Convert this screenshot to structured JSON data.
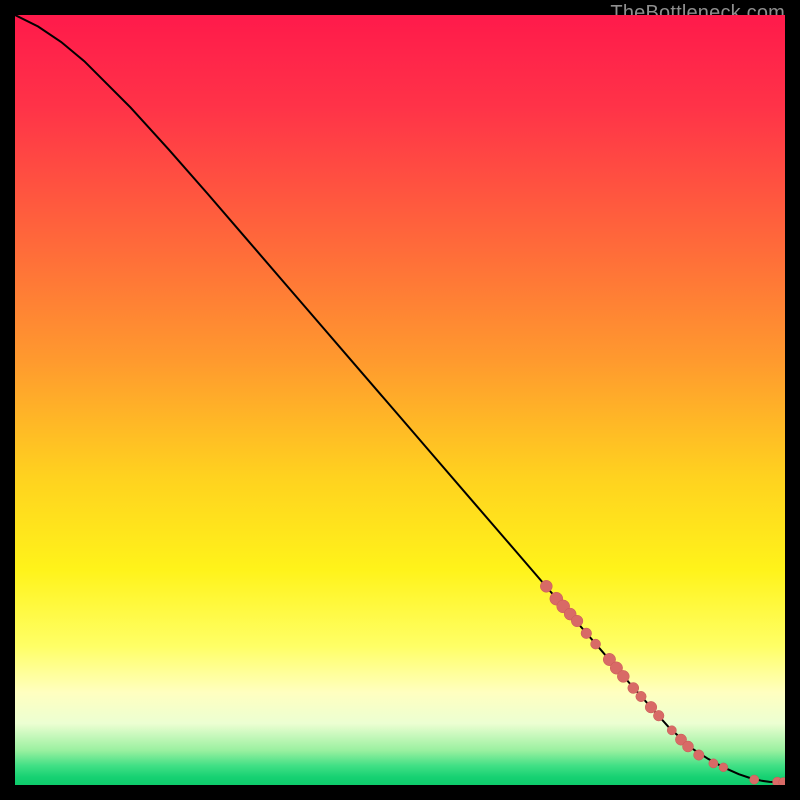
{
  "watermark": "TheBottleneck.com",
  "colors": {
    "gradient_stops": [
      {
        "offset": 0.0,
        "color": "#ff1a4b"
      },
      {
        "offset": 0.12,
        "color": "#ff3348"
      },
      {
        "offset": 0.3,
        "color": "#ff6a3a"
      },
      {
        "offset": 0.45,
        "color": "#ff9a2e"
      },
      {
        "offset": 0.6,
        "color": "#ffd21f"
      },
      {
        "offset": 0.72,
        "color": "#fff31a"
      },
      {
        "offset": 0.82,
        "color": "#ffff66"
      },
      {
        "offset": 0.88,
        "color": "#ffffc0"
      },
      {
        "offset": 0.92,
        "color": "#ecffd2"
      },
      {
        "offset": 0.955,
        "color": "#9af0a0"
      },
      {
        "offset": 0.975,
        "color": "#41e085"
      },
      {
        "offset": 0.99,
        "color": "#16d172"
      },
      {
        "offset": 1.0,
        "color": "#0ecb6b"
      }
    ],
    "curve": "#000000",
    "marker_fill": "#d86a66",
    "marker_stroke": "#c95a56"
  },
  "chart_data": {
    "type": "line",
    "title": "",
    "xlabel": "",
    "ylabel": "",
    "xlim": [
      0,
      100
    ],
    "ylim": [
      0,
      100
    ],
    "series": [
      {
        "name": "curve",
        "x": [
          0,
          3,
          6,
          9,
          12,
          15,
          20,
          25,
          30,
          35,
          40,
          45,
          50,
          55,
          60,
          65,
          70,
          75,
          80,
          85,
          88,
          90,
          92,
          94,
          95.5,
          97,
          98,
          99,
          100
        ],
        "y": [
          100,
          98.5,
          96.5,
          94,
          91,
          88,
          82.5,
          76.8,
          71,
          65.2,
          59.4,
          53.6,
          47.8,
          42,
          36.2,
          30.4,
          24.6,
          18.8,
          13,
          7.4,
          4.7,
          3.4,
          2.3,
          1.4,
          0.9,
          0.55,
          0.4,
          0.35,
          0.35
        ]
      }
    ],
    "markers": [
      {
        "x": 69.0,
        "y": 25.8,
        "r": 6.0
      },
      {
        "x": 70.3,
        "y": 24.2,
        "r": 6.5
      },
      {
        "x": 71.2,
        "y": 23.2,
        "r": 6.5
      },
      {
        "x": 72.1,
        "y": 22.2,
        "r": 6.0
      },
      {
        "x": 73.0,
        "y": 21.3,
        "r": 5.8
      },
      {
        "x": 74.2,
        "y": 19.7,
        "r": 5.3
      },
      {
        "x": 75.4,
        "y": 18.3,
        "r": 5.0
      },
      {
        "x": 77.2,
        "y": 16.3,
        "r": 6.2
      },
      {
        "x": 78.1,
        "y": 15.2,
        "r": 6.2
      },
      {
        "x": 79.0,
        "y": 14.1,
        "r": 6.0
      },
      {
        "x": 80.3,
        "y": 12.6,
        "r": 5.5
      },
      {
        "x": 81.3,
        "y": 11.5,
        "r": 5.2
      },
      {
        "x": 82.6,
        "y": 10.1,
        "r": 5.8
      },
      {
        "x": 83.6,
        "y": 9.0,
        "r": 5.3
      },
      {
        "x": 85.3,
        "y": 7.1,
        "r": 4.6
      },
      {
        "x": 86.5,
        "y": 5.9,
        "r": 5.6
      },
      {
        "x": 87.4,
        "y": 5.0,
        "r": 5.5
      },
      {
        "x": 88.8,
        "y": 3.9,
        "r": 5.2
      },
      {
        "x": 90.7,
        "y": 2.8,
        "r": 4.6
      },
      {
        "x": 92.0,
        "y": 2.3,
        "r": 4.4
      },
      {
        "x": 96.0,
        "y": 0.7,
        "r": 4.6
      },
      {
        "x": 99.0,
        "y": 0.4,
        "r": 4.8
      },
      {
        "x": 99.8,
        "y": 0.35,
        "r": 4.8
      }
    ]
  }
}
